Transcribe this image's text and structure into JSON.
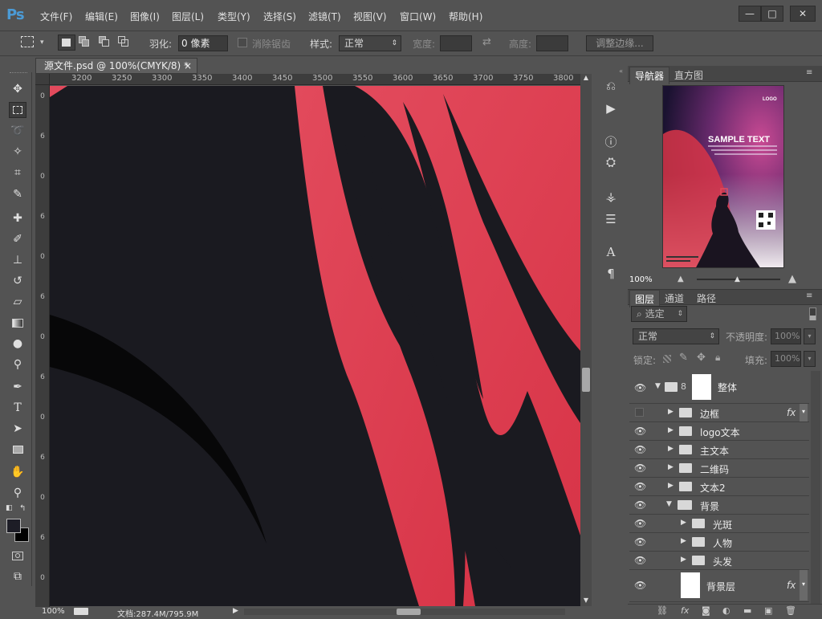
{
  "app": {
    "logo": "Ps"
  },
  "menu": [
    "文件(F)",
    "编辑(E)",
    "图像(I)",
    "图层(L)",
    "类型(Y)",
    "选择(S)",
    "滤镜(T)",
    "视图(V)",
    "窗口(W)",
    "帮助(H)"
  ],
  "window_buttons": {
    "minimize": "—",
    "maximize": "□",
    "close": "✕"
  },
  "options": {
    "feather_label": "羽化:",
    "feather_value": "0 像素",
    "antialias_label": "消除锯齿",
    "style_label": "样式:",
    "style_value": "正常",
    "width_label": "宽度:",
    "height_label": "高度:",
    "refine_edge": "调整边缘..."
  },
  "document_tab": {
    "title": "源文件.psd @ 100%(CMYK/8) *",
    "close": "×"
  },
  "ruler_h": [
    "3200",
    "3250",
    "3300",
    "3350",
    "3400",
    "3450",
    "3500",
    "3550",
    "3600",
    "3650",
    "3700",
    "3750",
    "3800"
  ],
  "ruler_v": [
    "0",
    "6",
    "0",
    "6",
    "0",
    "6",
    "0",
    "6",
    "0",
    "6",
    "0",
    "6",
    "0"
  ],
  "status": {
    "zoom": "100%",
    "doc_info": "文档:287.4M/795.9M"
  },
  "navigator": {
    "tabs": [
      "导航器",
      "直方图"
    ],
    "zoom": "100%",
    "thumb_text": "SAMPLE TEXT",
    "thumb_logo": "LOGO"
  },
  "layers_panel": {
    "tabs": [
      "图层",
      "通道",
      "路径"
    ],
    "filter": "选定",
    "blend_mode": "正常",
    "opacity_label": "不透明度:",
    "opacity_value": "100%",
    "lock_label": "锁定:",
    "fill_label": "填充:",
    "fill_value": "100%",
    "layers": [
      {
        "name": "整体",
        "type": "group-mask",
        "visible": true,
        "expanded": true,
        "indent": 0
      },
      {
        "name": "边框",
        "type": "group",
        "visible": false,
        "fx": true,
        "indent": 1
      },
      {
        "name": "logo文本",
        "type": "group",
        "visible": true,
        "indent": 1
      },
      {
        "name": "主文本",
        "type": "group",
        "visible": true,
        "indent": 1
      },
      {
        "name": "二维码",
        "type": "group",
        "visible": true,
        "indent": 1
      },
      {
        "name": "文本2",
        "type": "group",
        "visible": true,
        "indent": 1
      },
      {
        "name": "背景",
        "type": "group",
        "visible": true,
        "expanded": true,
        "indent": 1
      },
      {
        "name": "光斑",
        "type": "group",
        "visible": true,
        "indent": 2
      },
      {
        "name": "人物",
        "type": "group",
        "visible": true,
        "indent": 2
      },
      {
        "name": "头发",
        "type": "group",
        "visible": true,
        "indent": 2
      },
      {
        "name": "背景层",
        "type": "layer",
        "visible": true,
        "fx": true,
        "indent": 2
      }
    ],
    "fx_label": "fx"
  },
  "colors": {
    "accent_red": "#e0475a",
    "canvas_dark": "#1a1a20",
    "panel_bg": "#535353"
  }
}
